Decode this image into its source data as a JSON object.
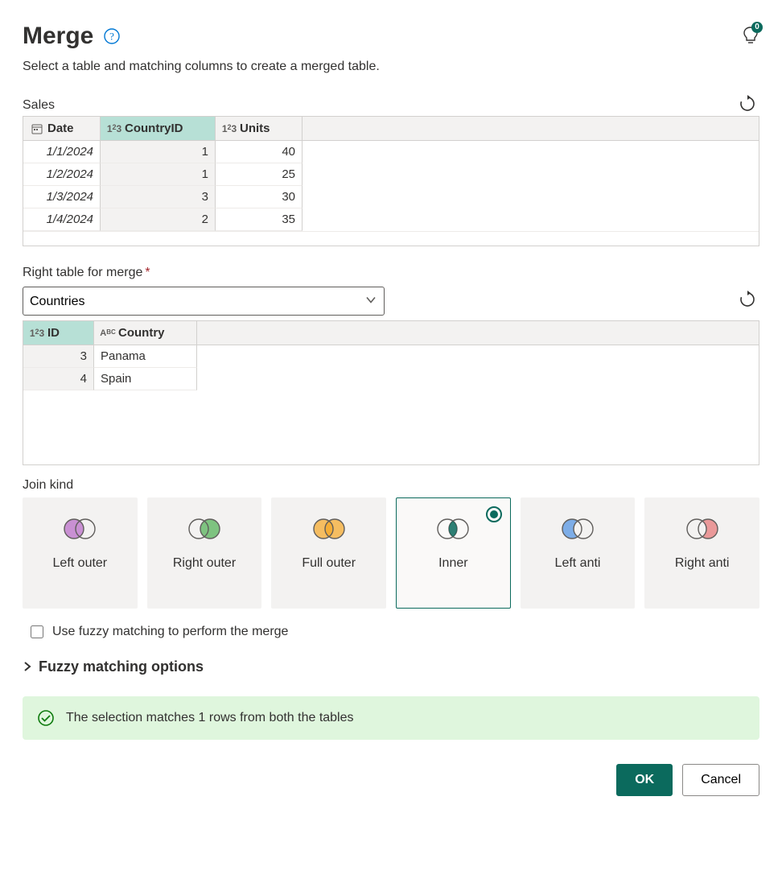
{
  "title": "Merge",
  "subtitle": "Select a table and matching columns to create a merged table.",
  "tips_badge": "0",
  "left_table": {
    "label": "Sales",
    "columns": [
      {
        "name": "Date",
        "type": "date",
        "selected": false
      },
      {
        "name": "CountryID",
        "type": "number",
        "selected": true
      },
      {
        "name": "Units",
        "type": "number",
        "selected": false
      }
    ],
    "rows": [
      {
        "Date": "1/1/2024",
        "CountryID": "1",
        "Units": "40"
      },
      {
        "Date": "1/2/2024",
        "CountryID": "1",
        "Units": "25"
      },
      {
        "Date": "1/3/2024",
        "CountryID": "3",
        "Units": "30"
      },
      {
        "Date": "1/4/2024",
        "CountryID": "2",
        "Units": "35"
      }
    ]
  },
  "right_table_section": {
    "label": "Right table for merge",
    "selected_option": "Countries",
    "options": [
      "Countries"
    ]
  },
  "right_table": {
    "columns": [
      {
        "name": "ID",
        "type": "number",
        "selected": true
      },
      {
        "name": "Country",
        "type": "text",
        "selected": false
      }
    ],
    "rows": [
      {
        "ID": "3",
        "Country": "Panama"
      },
      {
        "ID": "4",
        "Country": "Spain"
      }
    ]
  },
  "join": {
    "label": "Join kind",
    "options": [
      {
        "id": "left-outer",
        "label": "Left outer",
        "fill": "left",
        "color": "#b766c6"
      },
      {
        "id": "right-outer",
        "label": "Right outer",
        "fill": "right",
        "color": "#4caf50"
      },
      {
        "id": "full-outer",
        "label": "Full outer",
        "fill": "both",
        "color": "#f5a623"
      },
      {
        "id": "inner",
        "label": "Inner",
        "fill": "intersection",
        "color": "#0b6a5d"
      },
      {
        "id": "left-anti",
        "label": "Left anti",
        "fill": "left-only",
        "color": "#4a90e2"
      },
      {
        "id": "right-anti",
        "label": "Right anti",
        "fill": "right-only",
        "color": "#e57373"
      }
    ],
    "selected": "inner"
  },
  "fuzzy": {
    "checkbox_label": "Use fuzzy matching to perform the merge",
    "options_label": "Fuzzy matching options"
  },
  "match_message": "The selection matches 1 rows from both the tables",
  "buttons": {
    "ok": "OK",
    "cancel": "Cancel"
  }
}
